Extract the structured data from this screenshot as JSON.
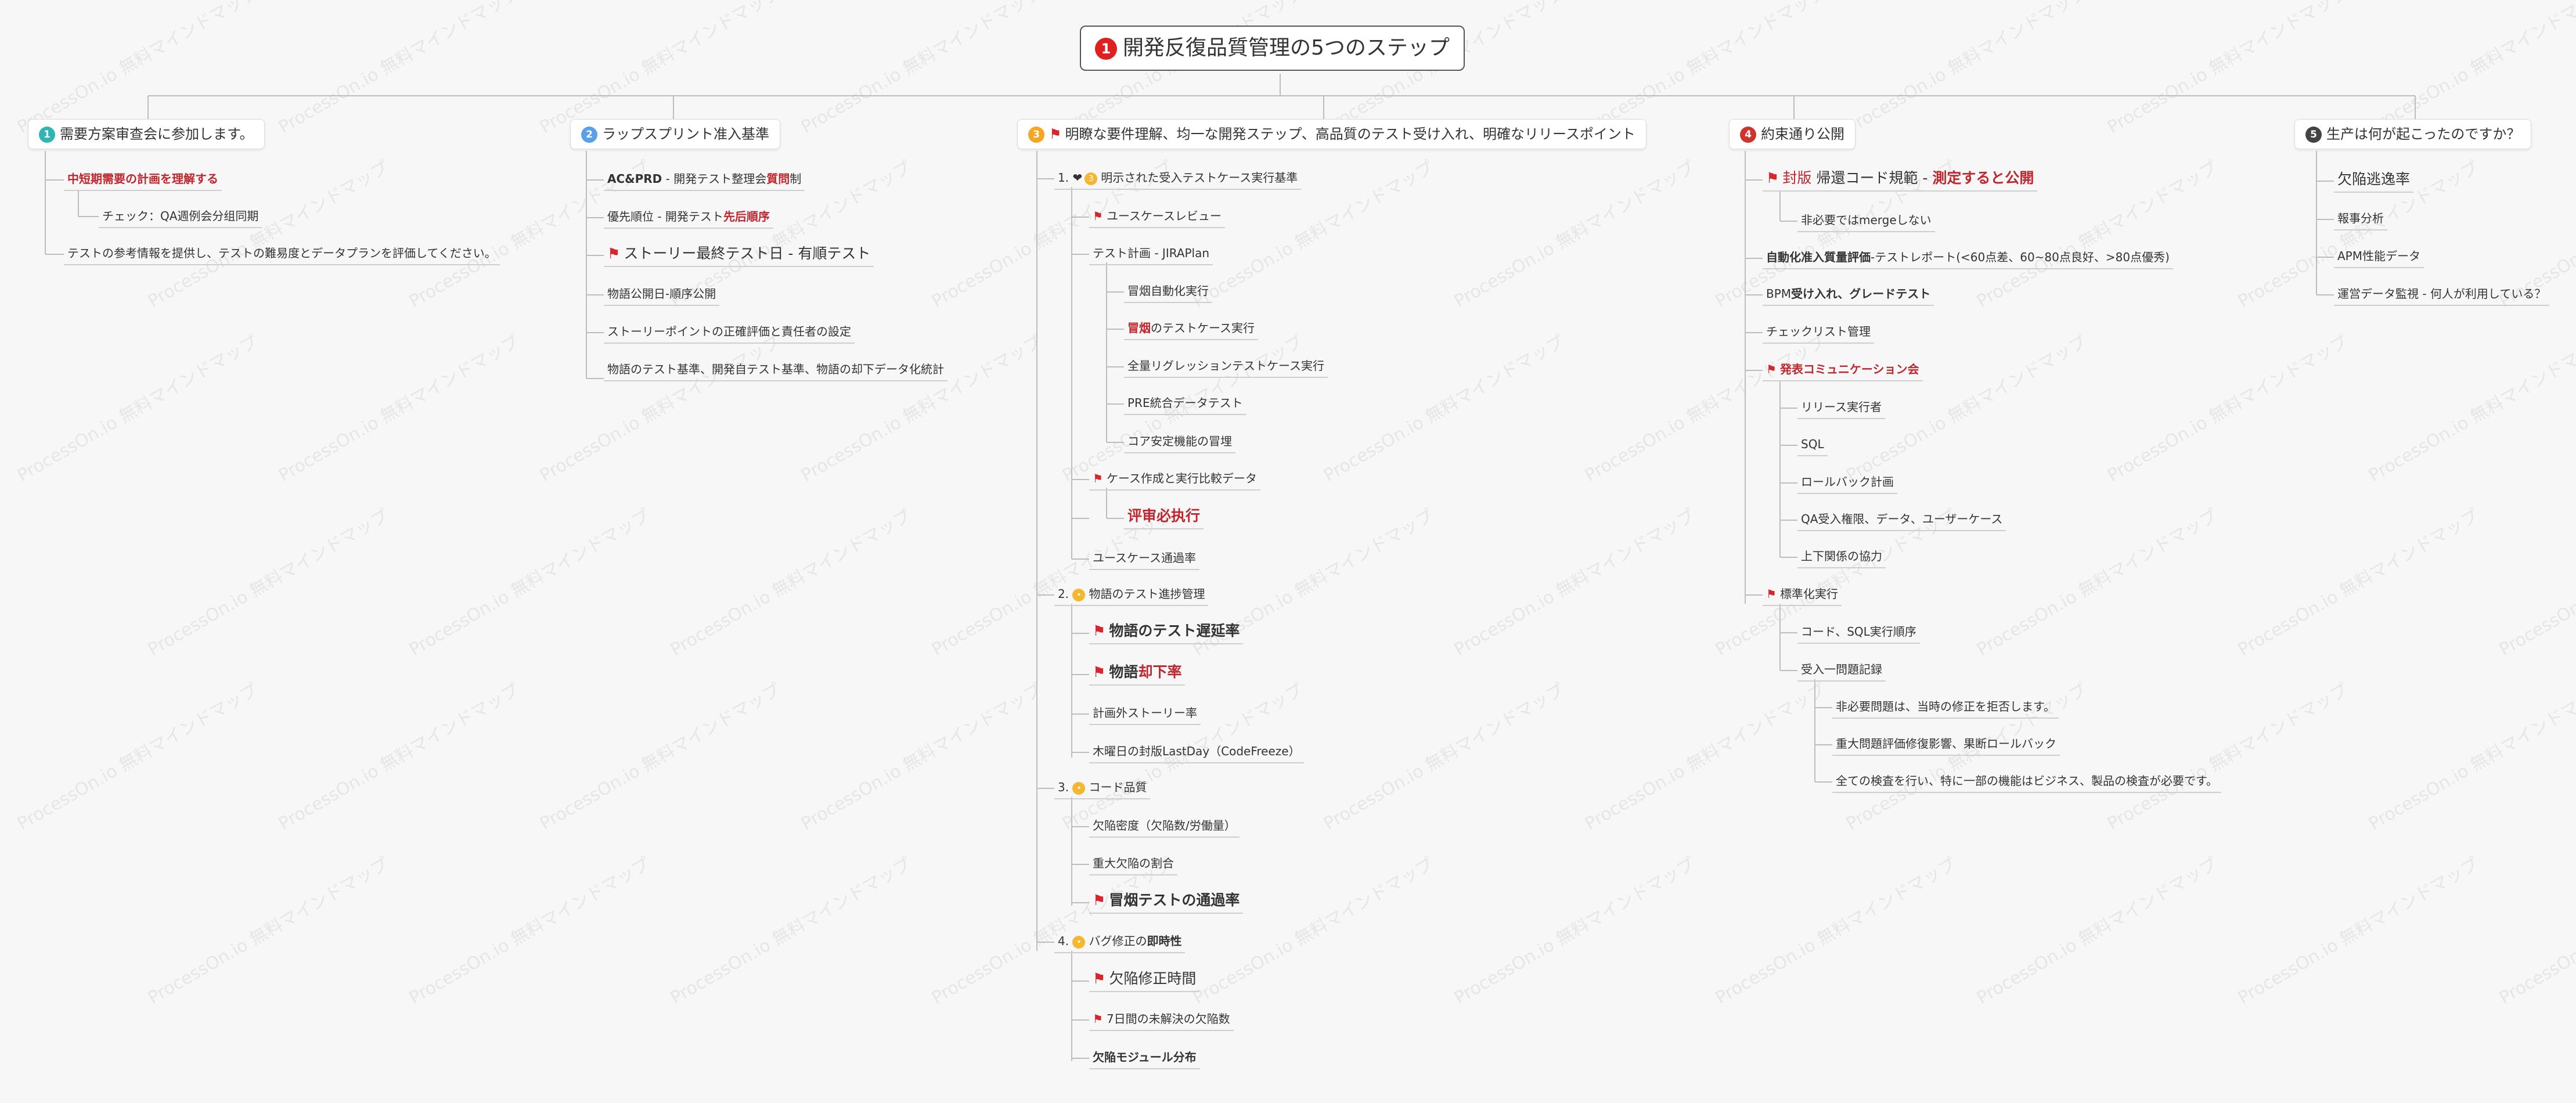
{
  "watermark_text": "ProcessOn.io 無料マインドマップ",
  "colors": {
    "root_badge": "#e02020",
    "teal": "#2fb6b4",
    "blue": "#5aa0e6",
    "orange": "#f5a623",
    "red": "#d0322d",
    "dark": "#444444",
    "flag": "#d9262d",
    "emphasis": "#c0262d"
  },
  "root": {
    "badge": "1",
    "text": "開発反復品質管理の5つのステップ"
  },
  "branches": [
    {
      "badge": "1",
      "text": "需要方案审查会に参加します。",
      "children": [
        {
          "text": "中短期需要の計画を理解する"
        },
        {
          "text": "チェック：QA週例会分组同期"
        },
        {
          "text": "テストの参考情報を提供し、テストの難易度とデータプランを評価してください。"
        }
      ]
    },
    {
      "badge": "2",
      "text": "ラップスプリント准入基準",
      "children": [
        {
          "a": "AC&PRD",
          "b": "- 開発テスト整理会",
          "c": "質問",
          "d": "制"
        },
        {
          "a": "優先順位 - 開発テスト",
          "b": "先后順序"
        },
        {
          "text": "ストーリー最終テスト日 - 有順テスト"
        },
        {
          "text": "物語公開日-順序公開"
        },
        {
          "text": "ストーリーポイントの正確評価と責任者の設定"
        },
        {
          "text": "物語のテスト基準、開発自テスト基準、物語の却下データ化統計"
        }
      ]
    },
    {
      "badge": "3",
      "text": "明瞭な要件理解、均一な開発ステップ、高品質のテスト受け入れ、明確なリリースポイント",
      "groups": [
        {
          "num": "1.",
          "text": "明示された受入テストケース実行基準",
          "items": [
            {
              "text": "ユースケースレビュー"
            },
            {
              "text": "テスト計画 - JIRAPlan"
            },
            {
              "text": "冒烟自動化実行"
            },
            {
              "a": "冒烟",
              "b": "のテストケース実行"
            },
            {
              "text": "全量リグレッションテストケース実行"
            },
            {
              "text": "PRE統合データテスト"
            },
            {
              "text": "コア安定機能の冒埋"
            },
            {
              "text": "ケース作成と実行比較データ"
            },
            {
              "text": "评审必执行"
            },
            {
              "text": "ユースケース通過率"
            }
          ]
        },
        {
          "num": "2.",
          "text": "物語のテスト進捗管理",
          "items": [
            {
              "text": "物語のテスト遅延率"
            },
            {
              "a": "物語",
              "b": "却下率"
            },
            {
              "text": "計画外ストーリー率"
            },
            {
              "text": "木曜日の封版LastDay（CodeFreeze）"
            }
          ]
        },
        {
          "num": "3.",
          "text": "コード品質",
          "items": [
            {
              "text": "欠陥密度（欠陥数/労働量）"
            },
            {
              "text": "重大欠陥の割合"
            },
            {
              "text": "冒烟テストの通過率"
            }
          ]
        },
        {
          "num": "4.",
          "a": "バグ修正の",
          "b": "即時性",
          "items": [
            {
              "text": "欠陥修正時間"
            },
            {
              "text": "7日間の未解決の欠陥数"
            },
            {
              "text": "欠陥モジュール分布"
            }
          ]
        }
      ]
    },
    {
      "badge": "4",
      "text": "約束通り公開",
      "children": [
        {
          "a": "封版",
          "b": "帰還コード規範 -",
          "c": "測定すると公開"
        },
        {
          "text": "非必要ではmergeしない"
        },
        {
          "a": "自動化准入質量評価",
          "b": "-テストレポート(<60点差、60~80点良好、>80点優秀)"
        },
        {
          "a": "BPM",
          "b": "受け入れ、グレードテスト"
        },
        {
          "text": "チェックリスト管理"
        },
        {
          "text": "発表コミュニケーション会"
        },
        {
          "text": "リリース実行者"
        },
        {
          "text": "SQL"
        },
        {
          "text": "ロールバック計画"
        },
        {
          "text": "QA受入権限、データ、ユーザーケース"
        },
        {
          "text": "上下関係の協力"
        },
        {
          "text": "標準化実行"
        },
        {
          "text": "コード、SQL実行順序"
        },
        {
          "text": "受入一問題記録"
        },
        {
          "text": "非必要問題は、当時の修正を拒否します。"
        },
        {
          "text": "重大問題評価修復影響、果断ロールバック"
        },
        {
          "text": "全ての検査を行い、特に一部の機能はビジネス、製品の検査が必要です。"
        }
      ]
    },
    {
      "badge": "5",
      "text": "生产は何が起こったのですか？",
      "children": [
        {
          "text": "欠陥逃逸率"
        },
        {
          "text": "報事分析"
        },
        {
          "text": "APM性能データ"
        },
        {
          "text": "運営データ監視 - 何人が利用している？"
        }
      ]
    }
  ]
}
